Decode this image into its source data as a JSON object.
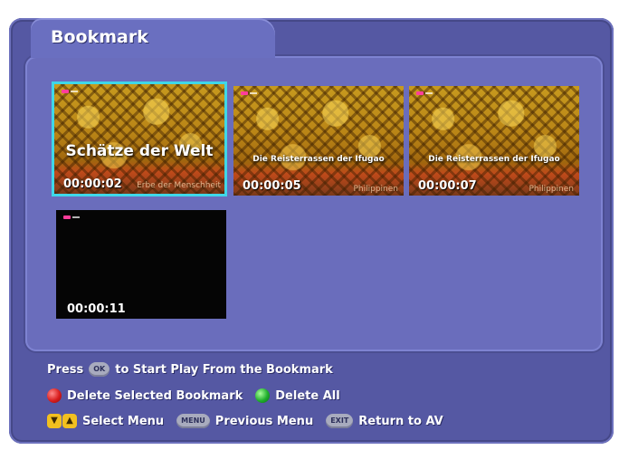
{
  "window": {
    "title": "Bookmark"
  },
  "bookmarks": [
    {
      "time": "00:00:02",
      "title": "Schätze der Welt",
      "subtitle": "Erbe der Menschheit",
      "selected": true
    },
    {
      "time": "00:00:05",
      "title": "Die Reisterrassen der Ifugao",
      "subtitle": "Philippinen",
      "selected": false
    },
    {
      "time": "00:00:07",
      "title": "Die Reisterrassen der Ifugao",
      "subtitle": "Philippinen",
      "selected": false
    },
    {
      "time": "00:00:11",
      "title": "",
      "subtitle": "",
      "selected": false
    }
  ],
  "legend": {
    "press": "Press",
    "ok_key": "OK",
    "play_text": "to Start Play From the Bookmark",
    "delete_selected": "Delete Selected Bookmark",
    "delete_all": "Delete All",
    "select_menu": "Select Menu",
    "menu_key": "MENU",
    "previous_menu": "Previous Menu",
    "exit_key": "EXIT",
    "return_av": "Return to AV"
  },
  "icons": {
    "ok": "ok-key-icon",
    "red": "red-button-icon",
    "green": "green-button-icon",
    "updown": "up-down-arrow-icon",
    "menu": "menu-key-icon",
    "exit": "exit-key-icon"
  },
  "colors": {
    "background": "#5558a3",
    "panel": "#6a6dbc",
    "selection": "#3fd7e8",
    "red": "#d81d1d",
    "green": "#1fae2c",
    "arrow": "#f2c01f"
  }
}
